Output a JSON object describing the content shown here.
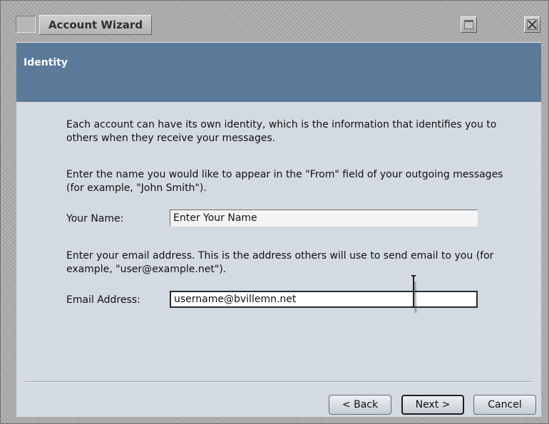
{
  "window": {
    "title": "Account Wizard"
  },
  "banner": {
    "title": "Identity"
  },
  "content": {
    "intro": "Each account can have its own identity, which is the information that identifies you to others when they receive your messages.",
    "name_instructions": "Enter the name you would like to appear in the \"From\" field of your outgoing messages (for example, \"John Smith\").",
    "name_label": "Your Name:",
    "name_value": "Enter Your Name",
    "email_instructions": "Enter your email address. This is the address others will use to send email to you (for example, \"user@example.net\").",
    "email_label": "Email Address:",
    "email_value": "username@bvillemn.net"
  },
  "buttons": {
    "back": "< Back",
    "next": "Next >",
    "cancel": "Cancel"
  },
  "icons": {
    "system_menu": "system-menu-icon",
    "maximize": "maximize-icon",
    "close": "close-icon",
    "cursor": "text-cursor-icon"
  },
  "colors": {
    "banner": "#5c7a9a",
    "panel": "#d3dae2",
    "chrome": "#adadad"
  }
}
